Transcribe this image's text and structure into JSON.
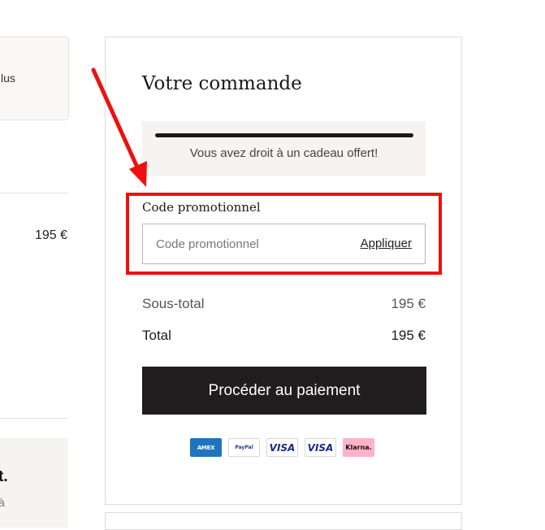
{
  "left_column": {
    "card_text": "lus",
    "price": "195 €",
    "card2_title": "t.",
    "card2_text": "à"
  },
  "order": {
    "title": "Votre commande",
    "gift_message": "Vous avez droit à un cadeau offert!",
    "promo": {
      "label": "Code promotionnel",
      "placeholder": "Code promotionnel",
      "apply_label": "Appliquer"
    },
    "subtotal": {
      "label": "Sous-total",
      "value": "195 €"
    },
    "total": {
      "label": "Total",
      "value": "195 €"
    },
    "pay_button_label": "Procéder au paiement",
    "payment_methods": [
      {
        "name": "amex-icon",
        "text": "AMEX"
      },
      {
        "name": "paypal-icon",
        "text": "PayPal"
      },
      {
        "name": "visa-icon",
        "text": "VISA"
      },
      {
        "name": "visa-electron-icon",
        "text": "VISA"
      },
      {
        "name": "klarna-icon",
        "text": "Klarna."
      }
    ]
  },
  "annotation": {
    "highlight_color": "#ee1010"
  }
}
